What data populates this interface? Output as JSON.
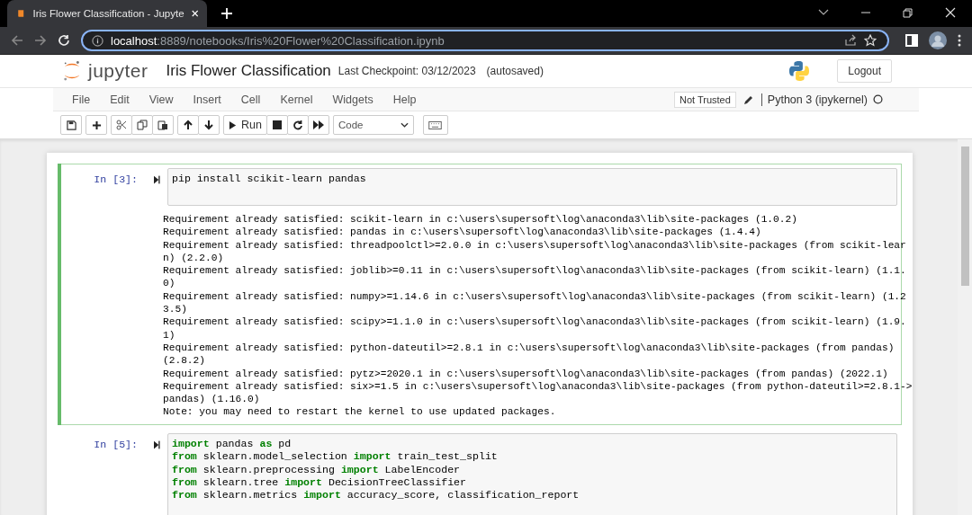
{
  "browser": {
    "tab": {
      "title": "Iris Flower Classification - Jupyte",
      "selected": true
    },
    "url": {
      "host": "localhost",
      "path": ":8889/notebooks/Iris%20Flower%20Classification.ipynb"
    }
  },
  "header": {
    "logo": "jupyter",
    "title": "Iris Flower Classification",
    "checkpoint": "Last Checkpoint: 03/12/2023",
    "autosave": "(autosaved)",
    "logout": "Logout"
  },
  "menu": [
    "File",
    "Edit",
    "View",
    "Insert",
    "Cell",
    "Kernel",
    "Widgets",
    "Help"
  ],
  "status": {
    "trusted": "Not Trusted",
    "kernel": "Python 3 (ipykernel)",
    "kernel_busy": false
  },
  "toolbar": {
    "run": "Run",
    "cell_type": "Code"
  },
  "cells": [
    {
      "prompt": "In [3]:",
      "selected": true,
      "input": [
        [
          {
            "text": "pip install scikit-learn pandas",
            "kind": "plain"
          }
        ]
      ],
      "output": [
        "Requirement already satisfied: scikit-learn in c:\\users\\supersoft\\log\\anaconda3\\lib\\site-packages (1.0.2)",
        "Requirement already satisfied: pandas in c:\\users\\supersoft\\log\\anaconda3\\lib\\site-packages (1.4.4)",
        "Requirement already satisfied: threadpoolctl>=2.0.0 in c:\\users\\supersoft\\log\\anaconda3\\lib\\site-packages (from scikit-lear",
        "n) (2.2.0)",
        "Requirement already satisfied: joblib>=0.11 in c:\\users\\supersoft\\log\\anaconda3\\lib\\site-packages (from scikit-learn) (1.1.",
        "0)",
        "Requirement already satisfied: numpy>=1.14.6 in c:\\users\\supersoft\\log\\anaconda3\\lib\\site-packages (from scikit-learn) (1.2",
        "3.5)",
        "Requirement already satisfied: scipy>=1.1.0 in c:\\users\\supersoft\\log\\anaconda3\\lib\\site-packages (from scikit-learn) (1.9.",
        "1)",
        "Requirement already satisfied: python-dateutil>=2.8.1 in c:\\users\\supersoft\\log\\anaconda3\\lib\\site-packages (from pandas)",
        "(2.8.2)",
        "Requirement already satisfied: pytz>=2020.1 in c:\\users\\supersoft\\log\\anaconda3\\lib\\site-packages (from pandas) (2022.1)",
        "Requirement already satisfied: six>=1.5 in c:\\users\\supersoft\\log\\anaconda3\\lib\\site-packages (from python-dateutil>=2.8.1->",
        "pandas) (1.16.0)",
        "Note: you may need to restart the kernel to use updated packages."
      ]
    },
    {
      "prompt": "In [5]:",
      "selected": false,
      "input": [
        [
          {
            "text": "import",
            "kind": "keyword"
          },
          {
            "text": " pandas ",
            "kind": "plain"
          },
          {
            "text": "as",
            "kind": "keyword"
          },
          {
            "text": " pd",
            "kind": "plain"
          }
        ],
        [
          {
            "text": "from",
            "kind": "keyword"
          },
          {
            "text": " sklearn.model_selection ",
            "kind": "plain"
          },
          {
            "text": "import",
            "kind": "keyword"
          },
          {
            "text": " train_test_split",
            "kind": "plain"
          }
        ],
        [
          {
            "text": "from",
            "kind": "keyword"
          },
          {
            "text": " sklearn.preprocessing ",
            "kind": "plain"
          },
          {
            "text": "import",
            "kind": "keyword"
          },
          {
            "text": " LabelEncoder",
            "kind": "plain"
          }
        ],
        [
          {
            "text": "from",
            "kind": "keyword"
          },
          {
            "text": " sklearn.tree ",
            "kind": "plain"
          },
          {
            "text": "import",
            "kind": "keyword"
          },
          {
            "text": " DecisionTreeClassifier",
            "kind": "plain"
          }
        ],
        [
          {
            "text": "from",
            "kind": "keyword"
          },
          {
            "text": " sklearn.metrics ",
            "kind": "plain"
          },
          {
            "text": "import",
            "kind": "keyword"
          },
          {
            "text": " accuracy_score, classification_report",
            "kind": "plain"
          }
        ]
      ]
    }
  ]
}
